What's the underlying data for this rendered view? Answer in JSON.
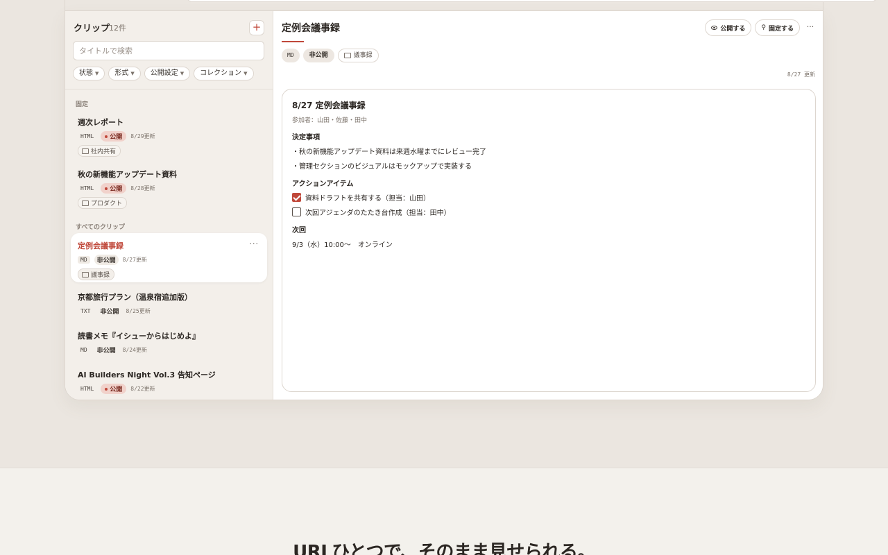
{
  "sidebar": {
    "title": "クリップ",
    "count": "12件",
    "add_label": "+",
    "search_placeholder": "タイトルで検索",
    "filters": [
      {
        "label": "状態"
      },
      {
        "label": "形式"
      },
      {
        "label": "公開設定"
      },
      {
        "label": "コレクション"
      }
    ],
    "pinned_label": "固定",
    "all_label": "すべてのクリップ",
    "pinned": [
      {
        "title": "週次レポート",
        "format": "HTML",
        "status": "公開",
        "updated": "8/29更新",
        "collection": "社内共有"
      },
      {
        "title": "秋の新機能アップデート資料",
        "format": "HTML",
        "status": "公開",
        "updated": "8/28更新",
        "collection": "プロダクト"
      }
    ],
    "clips": [
      {
        "title": "定例会議事録",
        "format": "MD",
        "status": "非公開",
        "updated": "8/27更新",
        "collection": "議事録",
        "more": "···"
      },
      {
        "title": "京都旅行プラン（温泉宿追加版）",
        "format": "TXT",
        "status": "非公開",
        "updated": "8/25更新"
      },
      {
        "title": "読書メモ『イシューからはじめよ』",
        "format": "MD",
        "status": "非公開",
        "updated": "8/24更新"
      },
      {
        "title": "AI Builders Night Vol.3 告知ページ",
        "format": "HTML",
        "status": "公開",
        "updated": "8/22更新"
      }
    ]
  },
  "detail": {
    "title": "定例会議事録",
    "publish_label": "公開する",
    "pin_label": "固定する",
    "more_label": "···",
    "format": "MD",
    "visibility": "非公開",
    "collection": "議事録",
    "updated": "8/27 更新",
    "card": {
      "heading": "8/27 定例会議事録",
      "participants": "参加者：山田・佐藤・田中",
      "decisions_heading": "決定事項",
      "decisions": [
        "・秋の新機能アップデート資料は来週水曜までにレビュー完了",
        "・管理セクションのビジュアルはモックアップで実装する"
      ],
      "actions_heading": "アクションアイテム",
      "actions": [
        {
          "text": "資料ドラフトを共有する（担当：山田）",
          "checked": true
        },
        {
          "text": "次回アジェンダのたたき台作成（担当：田中）",
          "checked": false
        }
      ],
      "next_heading": "次回",
      "next": "9/3（水）10:00〜　オンライン"
    }
  },
  "hero": {
    "headline": "URLひとつで、そのまま見せられる。"
  },
  "colors": {
    "accent": "#c0483a",
    "background": "#ebe6e0",
    "public_badge": "#f1d2cb"
  }
}
